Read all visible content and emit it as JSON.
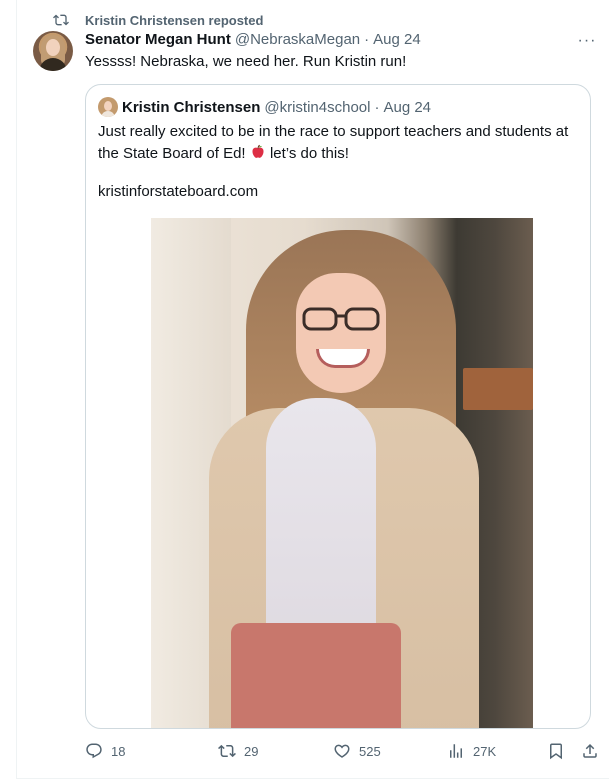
{
  "social_context": {
    "text": "Kristin Christensen reposted",
    "icon": "repost-icon"
  },
  "tweet": {
    "author_name": "Senator Megan Hunt",
    "author_handle": "@NebraskaMegan",
    "separator": "·",
    "date": "Aug 24",
    "text": "Yessss! Nebraska, we need her. Run Kristin run!",
    "more_label": "···"
  },
  "quote": {
    "author_name": "Kristin Christensen",
    "author_handle": "@kristin4school",
    "separator": "·",
    "date": "Aug 24",
    "text_line1": "Just really excited to be in the race to support teachers and students at",
    "text_line2a": "the State Board of Ed!",
    "text_line2b": "let’s do this!",
    "emoji": "apple-icon",
    "link": "kristinforstateboard.com"
  },
  "actions": {
    "replies": "18",
    "reposts": "29",
    "likes": "525",
    "views": "27K"
  },
  "colors": {
    "secondary_text": "#536471",
    "border": "#cfd9de",
    "primary_text": "#0f1419"
  }
}
